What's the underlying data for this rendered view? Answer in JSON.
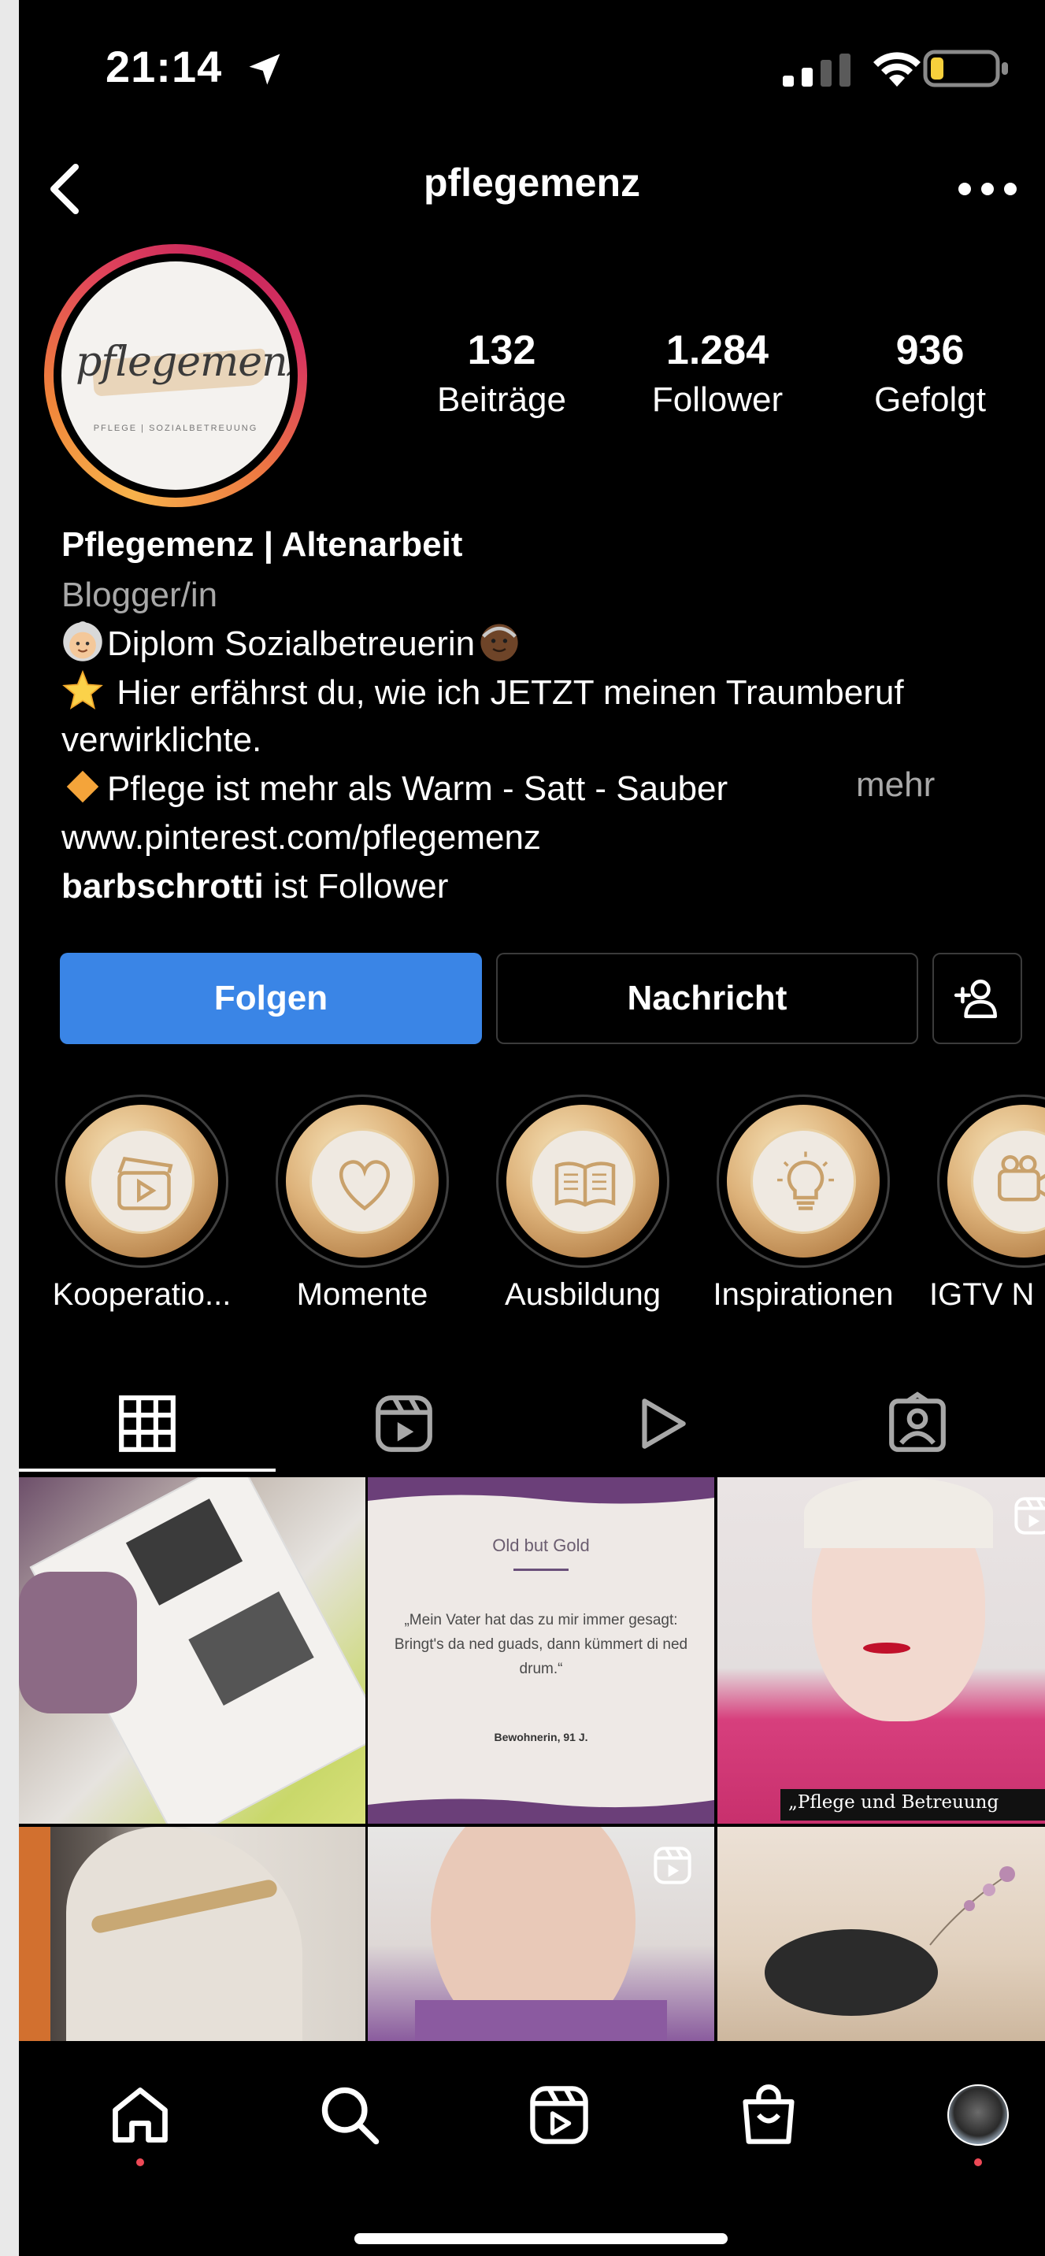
{
  "status_bar": {
    "time": "21:14"
  },
  "header": {
    "username": "pflegemenz"
  },
  "avatar": {
    "logo_text": "pflegemenz",
    "logo_subtext": "PFLEGE | SOZIALBETREUUNG"
  },
  "stats": [
    {
      "value": "132",
      "label": "Beiträge"
    },
    {
      "value": "1.284",
      "label": "Follower"
    },
    {
      "value": "936",
      "label": "Gefolgt"
    }
  ],
  "bio": {
    "name": "Pflegemenz | Altenarbeit",
    "category": "Blogger/in",
    "line1": "Diplom Sozialbetreuerin",
    "line2": " Hier erfährst du, wie ich JETZT meinen Traumberuf",
    "line3": "verwirklichte.",
    "line4": "Pflege ist mehr als Warm - Satt - Sauber",
    "more": "mehr",
    "link": "www.pinterest.com/pflegemenz",
    "followed_by_user": "barbschrotti",
    "followed_by_suffix": " ist Follower"
  },
  "buttons": {
    "follow": "Folgen",
    "message": "Nachricht"
  },
  "highlights": [
    {
      "label": "Kooperatio...",
      "icon": "video-clapper-icon"
    },
    {
      "label": "Momente",
      "icon": "heart-icon"
    },
    {
      "label": "Ausbildung",
      "icon": "open-book-icon"
    },
    {
      "label": "Inspirationen",
      "icon": "lightbulb-icon"
    },
    {
      "label": "IGTV N",
      "icon": "camera-icon"
    }
  ],
  "tabs": [
    "grid-icon",
    "reels-icon",
    "igtv-icon",
    "tagged-icon"
  ],
  "posts": {
    "quote": {
      "title": "Old but Gold",
      "text": "„Mein Vater hat das zu mir immer gesagt: Bringt's da ned guads, dann kümmert di ned drum.“",
      "author": "Bewohnerin, 91 J."
    },
    "reel_caption": "„Pflege und Betreuung"
  },
  "colors": {
    "follow_button": "#3a85e6",
    "notification_dot": "#ed4956",
    "background": "#000000"
  }
}
